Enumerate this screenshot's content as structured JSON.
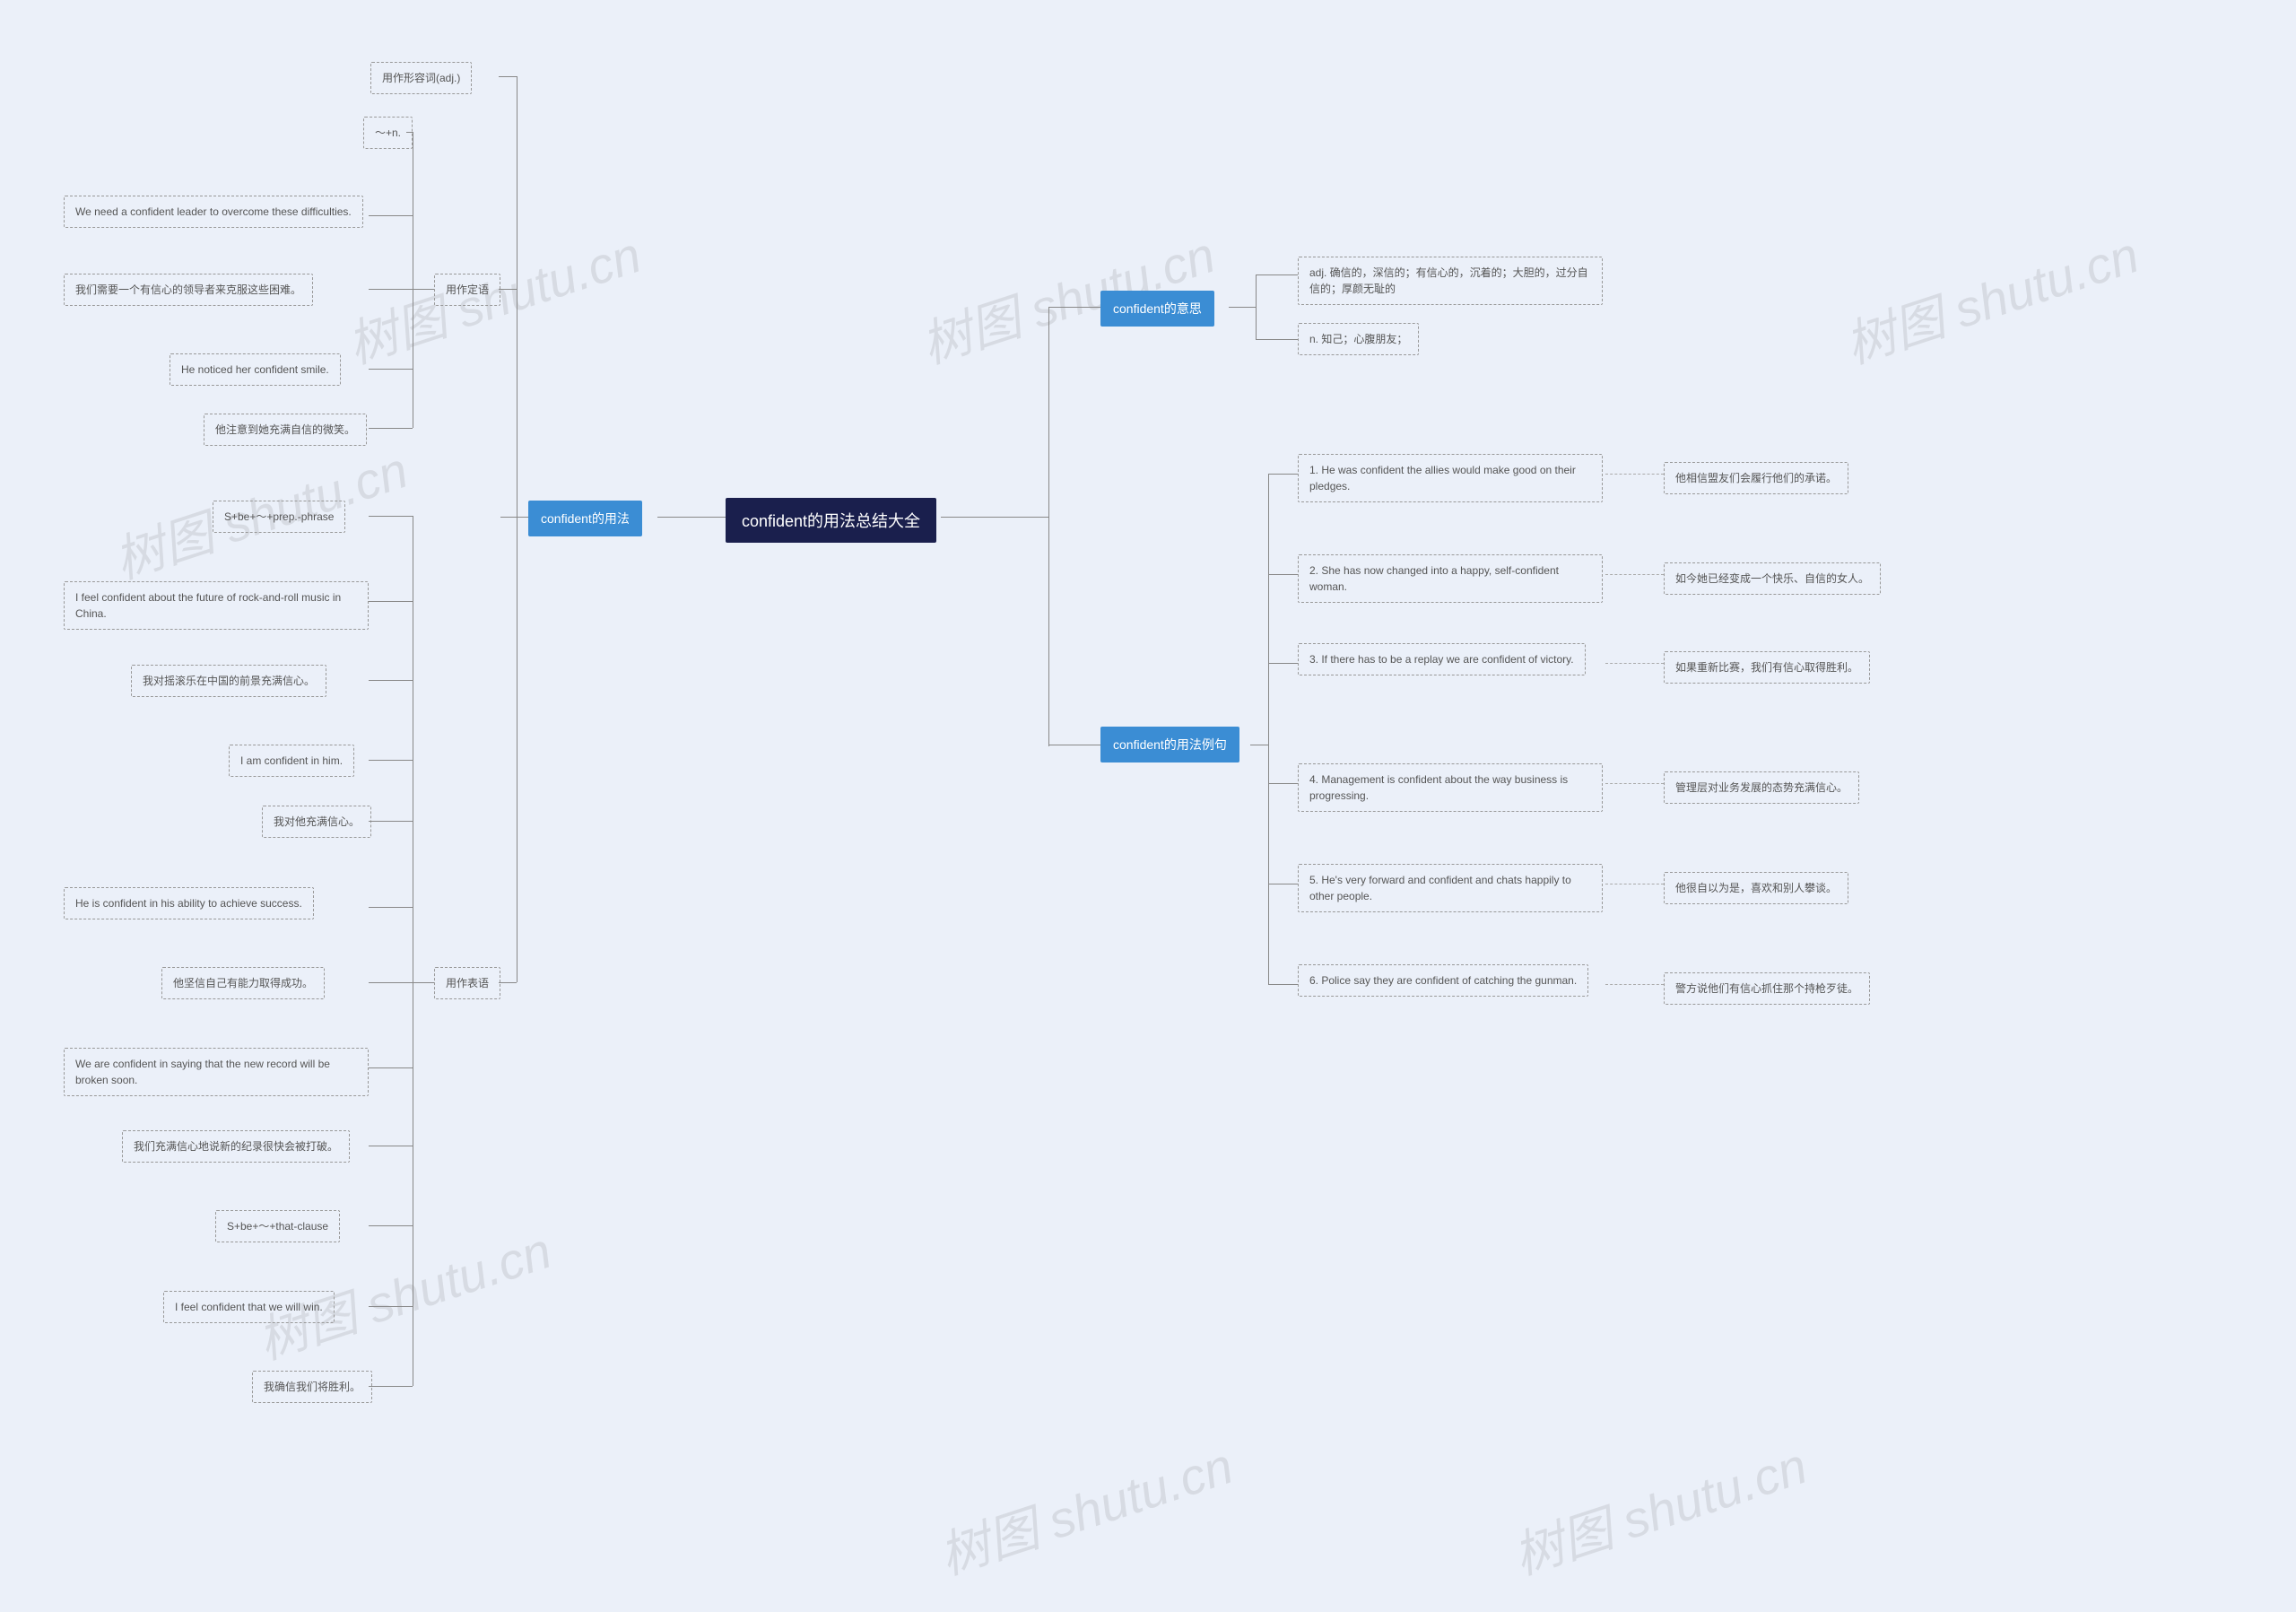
{
  "root": "confident的用法总结大全",
  "meaning_label": "confident的意思",
  "meaning_adj": "adj. 确信的，深信的；有信心的，沉着的；大胆的，过分自信的；厚颜无耻的",
  "meaning_n": "n. 知己；心腹朋友；",
  "examples_label": "confident的用法例句",
  "ex1_en": "1. He was confident the allies would make good on their pledges.",
  "ex1_zh": "他相信盟友们会履行他们的承诺。",
  "ex2_en": "2. She has now changed into a happy, self-confident woman.",
  "ex2_zh": "如今她已经变成一个快乐、自信的女人。",
  "ex3_en": "3. If there has to be a replay we are confident of victory.",
  "ex3_zh": "如果重新比赛，我们有信心取得胜利。",
  "ex4_en": "4. Management is confident about the way business is progressing.",
  "ex4_zh": "管理层对业务发展的态势充满信心。",
  "ex5_en": "5. He's very forward and confident and chats happily to other people.",
  "ex5_zh": "他很自以为是，喜欢和别人攀谈。",
  "ex6_en": "6. Police say they are confident of catching the gunman.",
  "ex6_zh": "警方说他们有信心抓住那个持枪歹徒。",
  "usage_label": "confident的用法",
  "usage_adj_label": "用作形容词(adj.)",
  "usage_attr_label": "用作定语",
  "usage_attr_n": "～+n.",
  "attr1_en": "We need a confident leader to overcome these difficulties.",
  "attr1_zh": "我们需要一个有信心的领导者来克服这些困难。",
  "attr2_en": "He noticed her confident smile.",
  "attr2_zh": "他注意到她充满自信的微笑。",
  "pred_label": "用作表语",
  "pred_prep": "S+be+～+prep.-phrase",
  "pred1_en": "I feel confident about the future of rock-and-roll music in China.",
  "pred1_zh": "我对摇滚乐在中国的前景充满信心。",
  "pred2_en": "I am confident in him.",
  "pred2_zh": "我对他充满信心。",
  "pred3_en": "He is confident in his ability to achieve success.",
  "pred3_zh": "他坚信自己有能力取得成功。",
  "pred4_en": "We are confident in saying that the new record will be broken soon.",
  "pred4_zh": "我们充满信心地说新的纪录很快会被打破。",
  "pred_that": "S+be+～+that-clause",
  "that1_en": "I feel confident that we will win.",
  "that1_zh": "我确信我们将胜利。",
  "watermark": "树图 shutu.cn"
}
